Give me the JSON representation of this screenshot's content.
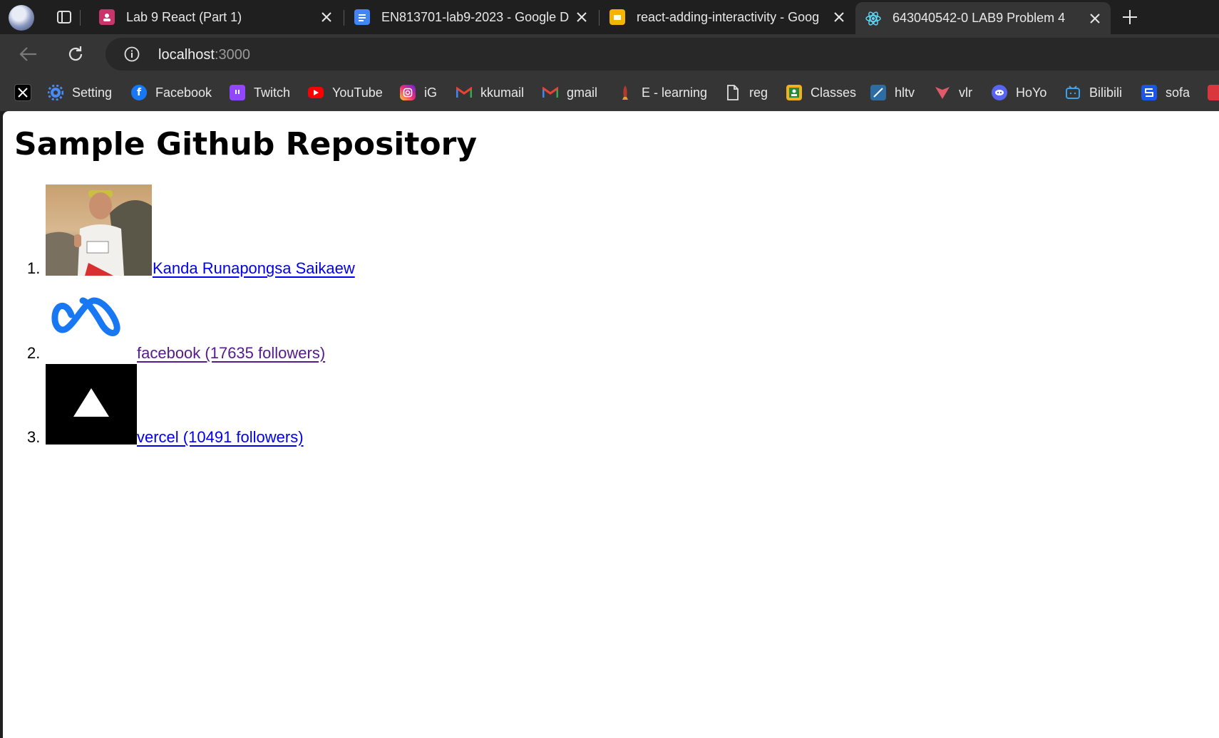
{
  "browser": {
    "tabs": [
      {
        "title": "Lab 9 React (Part 1)",
        "favicon": "classroom-icon",
        "active": false
      },
      {
        "title": "EN813701-lab9-2023 - Google D",
        "favicon": "google-docs-icon",
        "active": false
      },
      {
        "title": "react-adding-interactivity - Goog",
        "favicon": "google-slides-icon",
        "active": false
      },
      {
        "title": "643040542-0 LAB9 Problem 4",
        "favicon": "react-icon",
        "active": true
      }
    ],
    "address": {
      "host": "localhost",
      "port": ":3000"
    },
    "bookmarks": [
      {
        "label": "",
        "icon": "x-icon"
      },
      {
        "label": "Setting",
        "icon": "gear-icon"
      },
      {
        "label": "Facebook",
        "icon": "facebook-icon"
      },
      {
        "label": "Twitch",
        "icon": "twitch-icon"
      },
      {
        "label": "YouTube",
        "icon": "youtube-icon"
      },
      {
        "label": "iG",
        "icon": "instagram-icon"
      },
      {
        "label": "kkumail",
        "icon": "gmail-icon"
      },
      {
        "label": "gmail",
        "icon": "gmail-icon"
      },
      {
        "label": "E - learning",
        "icon": "rocket-icon"
      },
      {
        "label": "reg",
        "icon": "document-icon"
      },
      {
        "label": "Classes",
        "icon": "classroom-icon"
      },
      {
        "label": "hltv",
        "icon": "hltv-icon"
      },
      {
        "label": "vlr",
        "icon": "vlr-icon"
      },
      {
        "label": "HoYo",
        "icon": "discord-icon"
      },
      {
        "label": "Bilibili",
        "icon": "bilibili-icon"
      },
      {
        "label": "sofa",
        "icon": "sofascore-icon"
      }
    ]
  },
  "page": {
    "title": "Sample Github Repository",
    "repos": [
      {
        "number": "1.",
        "name": "Kanda Runapongsa Saikaew",
        "avatar": "profile-photo",
        "visited": false
      },
      {
        "number": "2.",
        "name": "facebook (17635 followers)",
        "avatar": "meta-logo-icon",
        "visited": true
      },
      {
        "number": "3.",
        "name": "vercel (10491 followers)",
        "avatar": "vercel-logo-icon",
        "visited": false
      }
    ]
  }
}
